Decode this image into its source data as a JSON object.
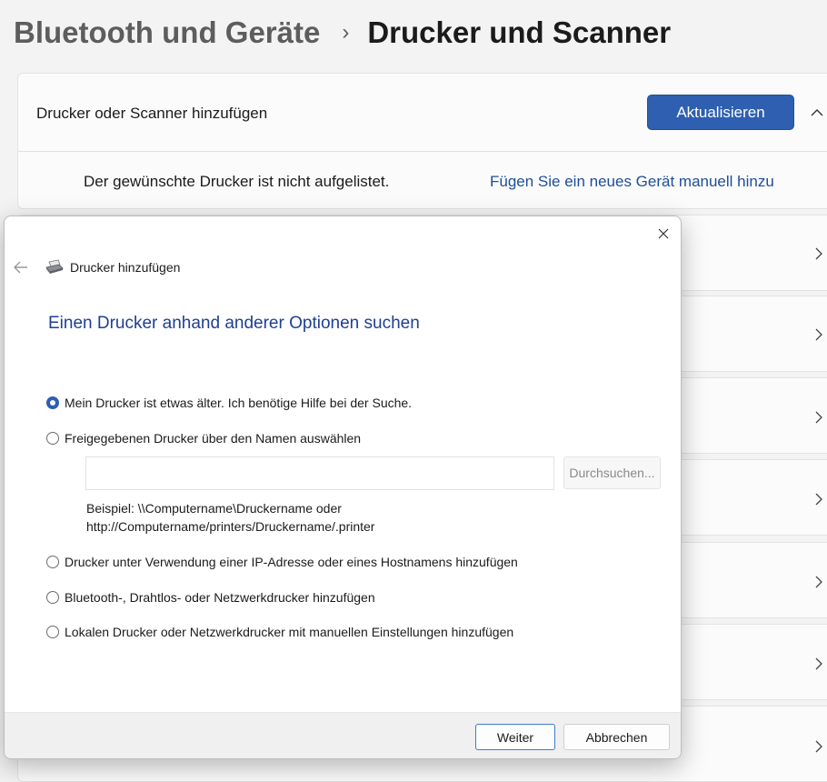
{
  "breadcrumb": {
    "parent": "Bluetooth und Geräte",
    "separator": "›",
    "current": "Drucker und Scanner"
  },
  "add_section": {
    "label": "Drucker oder Scanner hinzufügen",
    "refresh_button": "Aktualisieren",
    "not_listed_text": "Der gewünschte Drucker ist nicht aufgelistet.",
    "manual_link": "Fügen Sie ein neues Gerät manuell hinzu"
  },
  "dialog": {
    "title": "Drucker hinzufügen",
    "heading": "Einen Drucker anhand anderer Optionen suchen",
    "options": [
      {
        "label": "Mein Drucker ist etwas älter. Ich benötige Hilfe bei der Suche.",
        "checked": true
      },
      {
        "label": "Freigegebenen Drucker über den Namen auswählen",
        "checked": false
      },
      {
        "label": "Drucker unter Verwendung einer IP-Adresse oder eines Hostnamens hinzufügen",
        "checked": false
      },
      {
        "label": "Bluetooth-, Drahtlos- oder Netzwerkdrucker hinzufügen",
        "checked": false
      },
      {
        "label": "Lokalen Drucker oder Netzwerkdrucker mit manuellen Einstellungen hinzufügen",
        "checked": false
      }
    ],
    "name_input_value": "",
    "browse_button": "Durchsuchen...",
    "example_line1": "Beispiel: \\\\Computername\\Druckername oder",
    "example_line2": "http://Computername/printers/Druckername/.printer",
    "next_button": "Weiter",
    "cancel_button": "Abbrechen"
  },
  "icons": {
    "close": "close-icon",
    "back": "back-arrow-icon",
    "printer": "printer-icon",
    "collapse": "chevron-up-icon",
    "row": "chevron-right-icon"
  },
  "colors": {
    "accent": "#2e5fb0",
    "heading": "#1e3f94",
    "link": "#1f4e99",
    "background": "#f3f3f3"
  }
}
